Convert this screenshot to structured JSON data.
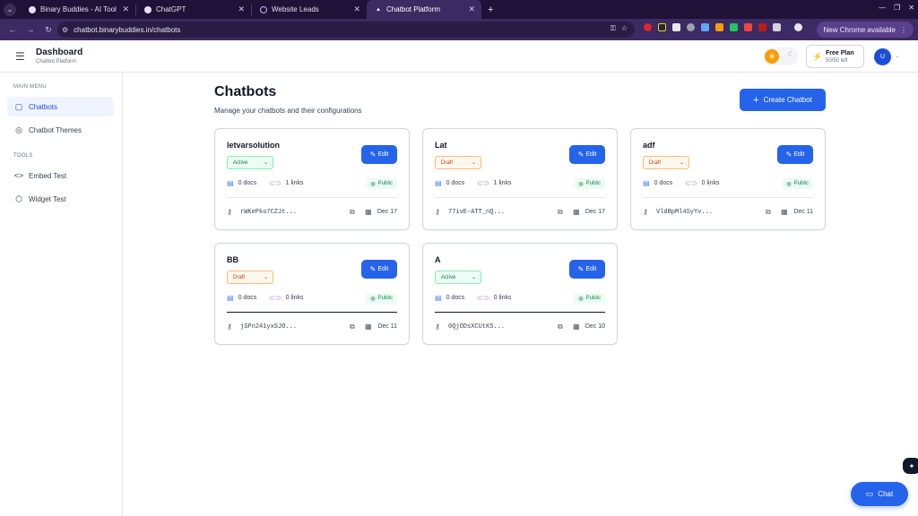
{
  "browser": {
    "tabs": [
      {
        "title": "Binary Buddies - AI Tool",
        "favicon_color": "#e5e0f2"
      },
      {
        "title": "ChatGPT",
        "favicon_color": "#e5e0f2"
      },
      {
        "title": "Website Leads",
        "favicon_color": "#c4b5fd"
      },
      {
        "title": "Chatbot Platform",
        "favicon_color": "#ffffff"
      }
    ],
    "url": "chatbot.binarybuddies.in/chatbots",
    "update_label": "New Chrome available"
  },
  "header": {
    "title": "Dashboard",
    "subtitle": "Chatbot Platform",
    "plan_name": "Free Plan",
    "plan_usage": "50/50 left",
    "avatar_initial": "U"
  },
  "sidebar": {
    "main_menu_label": "MAIN MENU",
    "tools_label": "TOOLS",
    "main_items": [
      {
        "label": "Chatbots",
        "icon": "message-square-icon"
      },
      {
        "label": "Chatbot Themes",
        "icon": "palette-icon"
      }
    ],
    "tool_items": [
      {
        "label": "Embed Test",
        "icon": "code-icon"
      },
      {
        "label": "Widget Test",
        "icon": "box-icon"
      }
    ]
  },
  "main": {
    "title": "Chatbots",
    "subtitle": "Manage your chatbots and their configurations",
    "create_label": "Create Chatbot",
    "edit_label": "Edit",
    "docs_suffix": "docs",
    "links_suffix": "links",
    "chatbots": [
      {
        "name": "letvarsolution",
        "status": "Active",
        "docs": "0",
        "links": "1",
        "visibility": "Public",
        "key": "rWKePko7CZJt...",
        "date": "Dec 17"
      },
      {
        "name": "Lat",
        "status": "Draft",
        "docs": "0",
        "links": "1",
        "visibility": "Public",
        "key": "77ivE-ATT_nQ...",
        "date": "Dec 17"
      },
      {
        "name": "adf",
        "status": "Draft",
        "docs": "0",
        "links": "0",
        "visibility": "Public",
        "key": "VldBpMl4SyYv...",
        "date": "Dec 11"
      },
      {
        "name": "BB",
        "status": "Draft",
        "docs": "0",
        "links": "0",
        "visibility": "Public",
        "key": "jSPn241yxSJO...",
        "date": "Dec 11"
      },
      {
        "name": "A",
        "status": "Active",
        "docs": "0",
        "links": "0",
        "visibility": "Public",
        "key": "0QjODsXCUtK5...",
        "date": "Dec 10"
      }
    ]
  },
  "chat_widget": {
    "label": "Chat"
  },
  "colors": {
    "accent": "#2563eb",
    "active": "#15803d",
    "draft": "#c2410c",
    "browser_frame": "#3c2a62"
  }
}
